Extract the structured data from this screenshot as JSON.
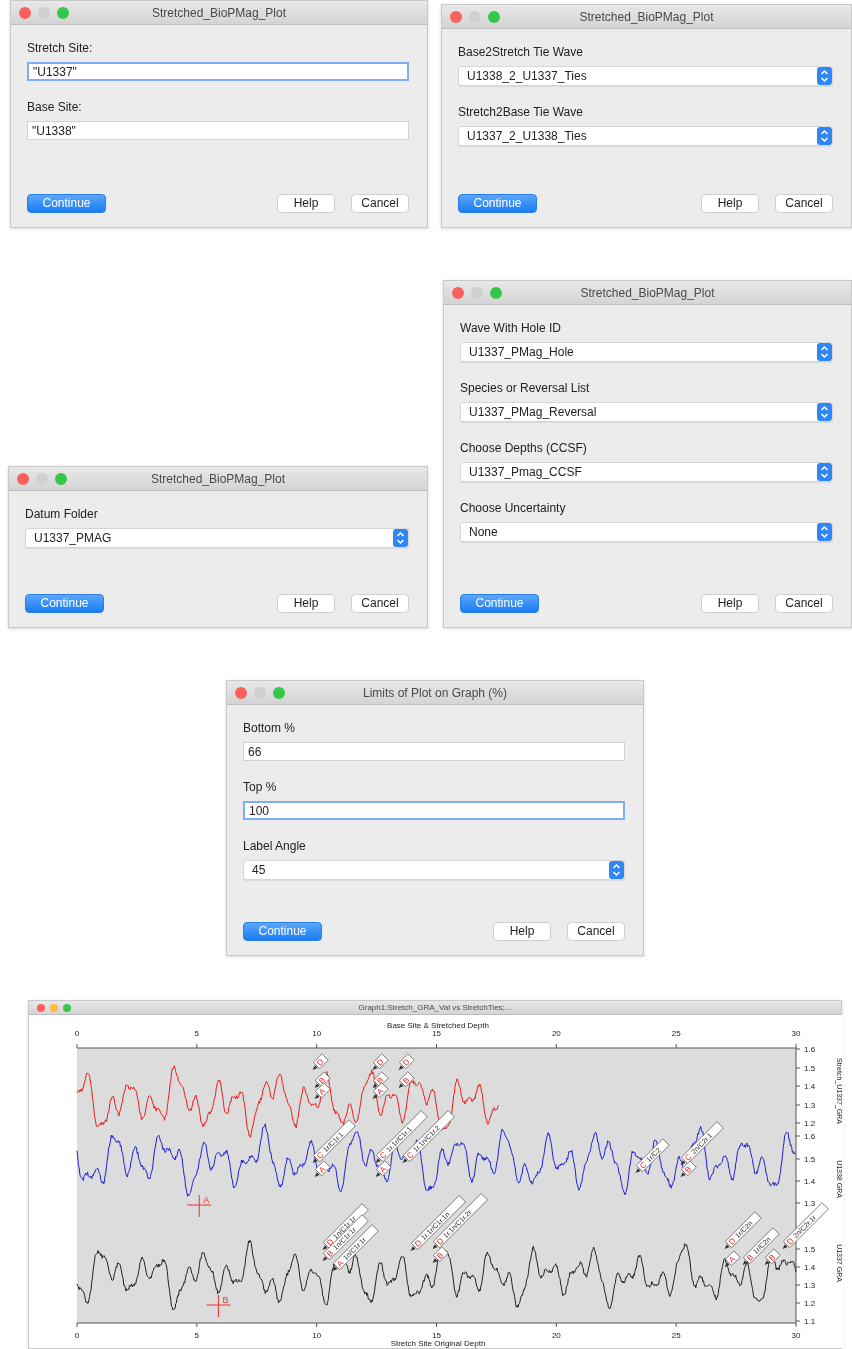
{
  "windows": [
    {
      "title": "Stretched_BioPMag_Plot",
      "minimize_enabled": false,
      "fields": [
        {
          "kind": "text",
          "label": "Stretch Site:",
          "value": "\"U1337\"",
          "focused": true
        },
        {
          "kind": "text",
          "label": "Base Site:",
          "value": "\"U1338\"",
          "focused": false
        }
      ],
      "buttons": [
        {
          "label": "Continue",
          "default": true
        },
        {
          "label": "Help",
          "default": false
        },
        {
          "label": "Cancel",
          "default": false
        }
      ]
    },
    {
      "title": "Stretched_BioPMag_Plot",
      "minimize_enabled": false,
      "fields": [
        {
          "kind": "select",
          "label": "Base2Stretch Tie Wave",
          "value": "U1338_2_U1337_Ties",
          "focused": false
        },
        {
          "kind": "select",
          "label": "Stretch2Base Tie Wave",
          "value": "U1337_2_U1338_Ties",
          "focused": false
        }
      ],
      "buttons": [
        {
          "label": "Continue",
          "default": true
        },
        {
          "label": "Help",
          "default": false
        },
        {
          "label": "Cancel",
          "default": false
        }
      ]
    },
    {
      "title": "Stretched_BioPMag_Plot",
      "minimize_enabled": false,
      "fields": [
        {
          "kind": "select",
          "label": "Datum Folder",
          "value": "U1337_PMAG",
          "focused": false
        }
      ],
      "buttons": [
        {
          "label": "Continue",
          "default": true
        },
        {
          "label": "Help",
          "default": false
        },
        {
          "label": "Cancel",
          "default": false
        }
      ]
    },
    {
      "title": "Stretched_BioPMag_Plot",
      "minimize_enabled": false,
      "fields": [
        {
          "kind": "select",
          "label": "Wave With Hole ID",
          "value": "U1337_PMag_Hole",
          "focused": false
        },
        {
          "kind": "select",
          "label": "Species or Reversal List",
          "value": "U1337_PMag_Reversal",
          "focused": false
        },
        {
          "kind": "select",
          "label": "Choose Depths (CCSF)",
          "value": "U1337_Pmag_CCSF",
          "focused": false
        },
        {
          "kind": "select",
          "label": "Choose Uncertainty",
          "value": "None",
          "focused": false
        }
      ],
      "buttons": [
        {
          "label": "Continue",
          "default": true
        },
        {
          "label": "Help",
          "default": false
        },
        {
          "label": "Cancel",
          "default": false
        }
      ]
    },
    {
      "title": "Limits of Plot on Graph (%)",
      "minimize_enabled": false,
      "fields": [
        {
          "kind": "text",
          "label": "Bottom %",
          "value": "66",
          "focused": false
        },
        {
          "kind": "text",
          "label": "Top %",
          "value": "100",
          "focused": true
        },
        {
          "kind": "select",
          "label": "Label Angle",
          "value": "45",
          "focused": false
        }
      ],
      "buttons": [
        {
          "label": "Continue",
          "default": true
        },
        {
          "label": "Help",
          "default": false
        },
        {
          "label": "Cancel",
          "default": false
        }
      ]
    }
  ],
  "graph_window": {
    "title": "Graph1:Stretch_GRA_Val vs StretchTies;...",
    "minimize_enabled": true,
    "top_axis": {
      "title": "Base Site & Stretched Depth",
      "ticks": [
        "0",
        "5",
        "10",
        "15",
        "20",
        "25",
        "30"
      ]
    },
    "bottom_axis": {
      "title": "Stretch Site Original Depth",
      "ticks": [
        "0",
        "5",
        "10",
        "15",
        "20",
        "25",
        "30"
      ]
    },
    "right_axes": [
      {
        "title": "Stretch_U1337_GRA",
        "ticks": [
          "1.6",
          "1.5",
          "1.4",
          "1.3",
          "1.2"
        ]
      },
      {
        "title": "U1338 GRA",
        "ticks": [
          "1.6",
          "1.5",
          "1.4",
          "1.3"
        ]
      },
      {
        "title": "U1337 GRA",
        "ticks": [
          "1.5",
          "1.4",
          "1.3",
          "1.2",
          "1.1"
        ]
      }
    ],
    "ties": [
      {
        "letter": "D"
      },
      {
        "letter": "B"
      },
      {
        "letter": "A"
      },
      {
        "letter": "D"
      },
      {
        "letter": "B"
      },
      {
        "letter": "A"
      },
      {
        "letter": "D"
      },
      {
        "letter": "B"
      },
      {
        "letter": "C",
        "text": "1r/C1r.1"
      },
      {
        "letter": "A"
      },
      {
        "letter": "C",
        "text": "1r.1r/C1r.1"
      },
      {
        "letter": "A"
      },
      {
        "letter": "C",
        "text": "1r.1n/C1r.2"
      },
      {
        "letter": "C",
        "text": "1r/C2"
      },
      {
        "letter": "C",
        "text": "2n/C2r.1"
      },
      {
        "letter": "B"
      },
      {
        "letter": "D",
        "text": "1n/C1r.1r"
      },
      {
        "letter": "B",
        "text": "1n/C1r.1r"
      },
      {
        "letter": "A",
        "text": "1n/C1r.1r"
      },
      {
        "letter": "D",
        "text": "1r.1r/C1r.1n"
      },
      {
        "letter": "D",
        "text": "1r.1n/C1r.2r"
      },
      {
        "letter": "B"
      },
      {
        "letter": "D",
        "text": "1r/C2n"
      },
      {
        "letter": "A"
      },
      {
        "letter": "B",
        "text": "1r/C2n"
      },
      {
        "letter": "B"
      },
      {
        "letter": "D",
        "text": "2n/C2r.1r"
      }
    ],
    "markers": [
      {
        "label": "A"
      },
      {
        "label": "B"
      }
    ]
  }
}
